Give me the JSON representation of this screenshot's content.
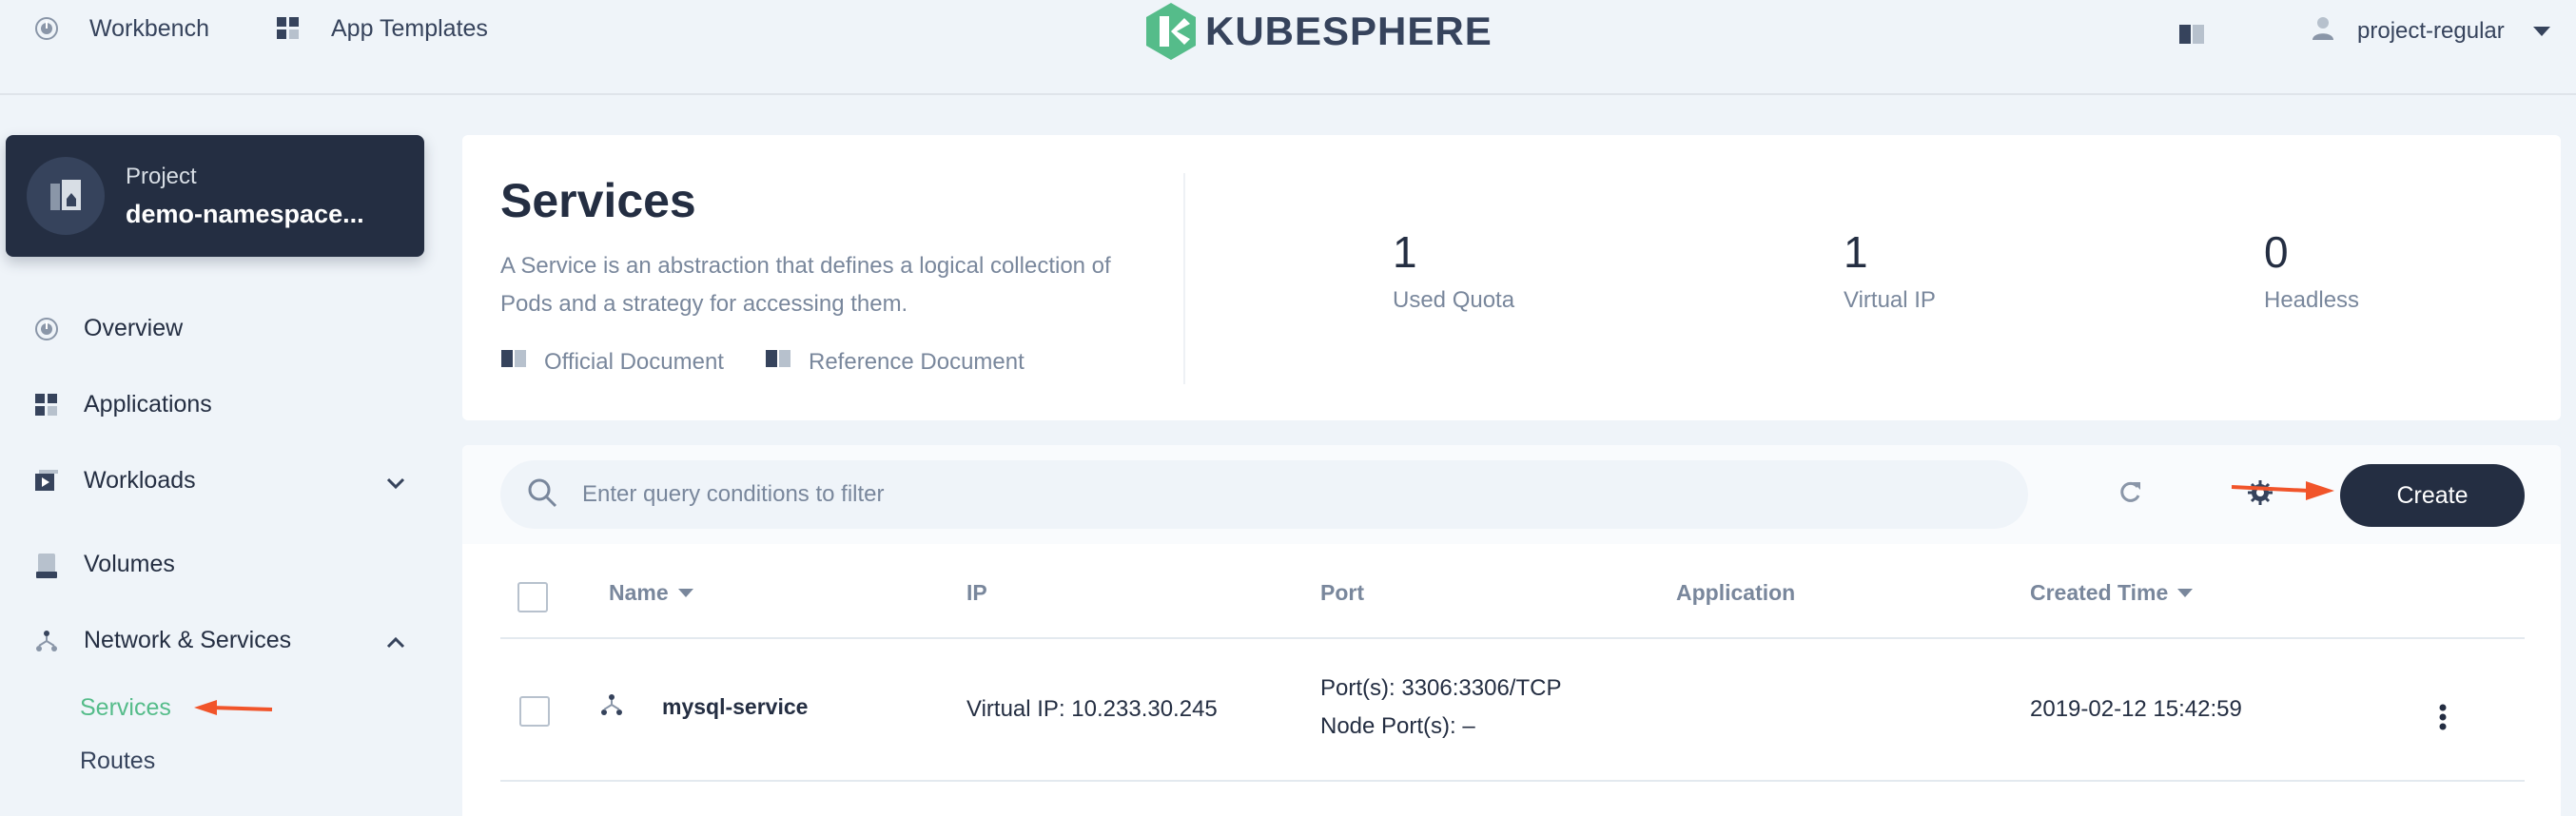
{
  "topnav": {
    "workbench": "Workbench",
    "app_templates": "App Templates",
    "logo_text": "KUBESPHERE",
    "user": "project-regular"
  },
  "project": {
    "label": "Project",
    "name": "demo-namespace..."
  },
  "sidebar": {
    "items": [
      {
        "label": "Overview"
      },
      {
        "label": "Applications"
      },
      {
        "label": "Workloads"
      },
      {
        "label": "Volumes"
      },
      {
        "label": "Network & Services"
      }
    ],
    "sub_items": [
      {
        "label": "Services",
        "active": true
      },
      {
        "label": "Routes",
        "active": false
      }
    ]
  },
  "header": {
    "title": "Services",
    "description": "A Service is an abstraction that defines a logical collection of Pods and a strategy for accessing them.",
    "links": [
      "Official Document",
      "Reference Document"
    ],
    "stats": [
      {
        "value": "1",
        "label": "Used Quota"
      },
      {
        "value": "1",
        "label": "Virtual IP"
      },
      {
        "value": "0",
        "label": "Headless"
      }
    ]
  },
  "toolbar": {
    "search_placeholder": "Enter query conditions to filter",
    "create_label": "Create"
  },
  "table": {
    "columns": [
      "Name",
      "IP",
      "Port",
      "Application",
      "Created Time"
    ],
    "rows": [
      {
        "name": "mysql-service",
        "ip_label": "Virtual IP:",
        "ip": "10.233.30.245",
        "port_label": "Port(s):",
        "port": "3306:3306/TCP",
        "node_port_label": "Node Port(s):",
        "node_port": "–",
        "application": "",
        "created": "2019-02-12 15:42:59"
      }
    ]
  },
  "colors": {
    "dark": "#242e42",
    "accent_green": "#55bc8a",
    "annotation_arrow": "#f1542a",
    "muted": "#79879c",
    "background": "#eff4f9"
  }
}
